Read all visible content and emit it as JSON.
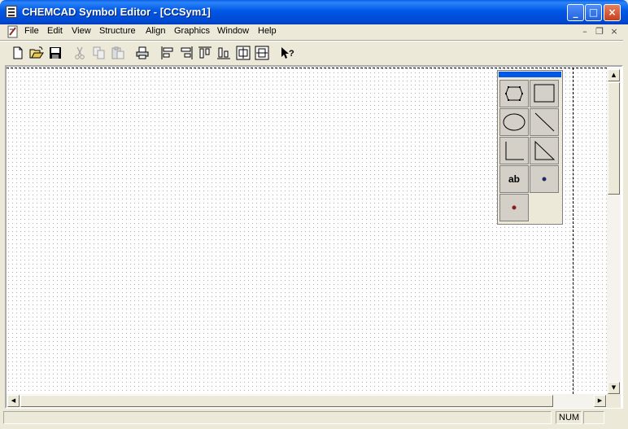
{
  "window": {
    "title": "CHEMCAD Symbol Editor - [CCSym1]",
    "buttons": {
      "minimize": "_",
      "maximize": "□",
      "close": "×"
    }
  },
  "menu": {
    "items": [
      "File",
      "Edit",
      "View",
      "Structure",
      "Align",
      "Graphics",
      "Window",
      "Help"
    ],
    "mdi_controls": {
      "minimize": "–",
      "restore": "❐",
      "close": "×"
    }
  },
  "toolbar": {
    "icons": [
      "new-icon",
      "open-icon",
      "save-icon",
      "cut-icon",
      "copy-icon",
      "paste-icon",
      "print-icon",
      "align-left-icon",
      "align-right-icon",
      "align-top-icon",
      "align-bottom-icon",
      "center-horizontal-icon",
      "center-vertical-icon",
      "context-help-icon"
    ]
  },
  "palette": {
    "tools": [
      "polygon-icon",
      "rectangle-icon",
      "ellipse-icon",
      "line-icon",
      "polyline-icon",
      "triangle-icon",
      "text-tool",
      "point-icon",
      "connection-point-icon"
    ],
    "text_label": "ab",
    "title_color": "#0058e6"
  },
  "status": {
    "num": "NUM"
  },
  "colors": {
    "titlebar": "#0054e3",
    "chrome": "#ece9d8",
    "grid_dot": "#b0b0b0"
  }
}
